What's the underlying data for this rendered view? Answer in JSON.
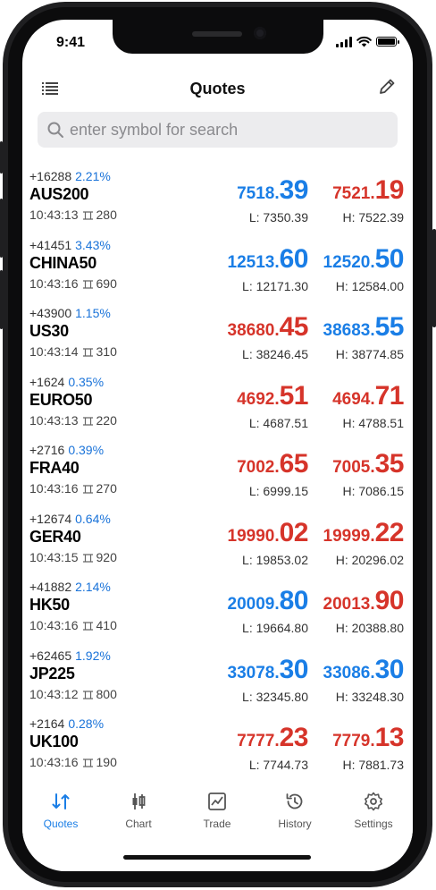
{
  "status": {
    "time": "9:41"
  },
  "header": {
    "title": "Quotes"
  },
  "search": {
    "placeholder": "enter symbol for search"
  },
  "colors": {
    "up": "#1a7ee6",
    "down": "#d6342a",
    "accent": "#1a7ee6"
  },
  "quotes": [
    {
      "change": "+16288",
      "pct": "2.21%",
      "symbol": "AUS200",
      "time": "10:43:13",
      "spread": "280",
      "bid_small": "7518.",
      "bid_big": "39",
      "bid_color": "blue",
      "ask_small": "7521.",
      "ask_big": "19",
      "ask_color": "red",
      "low": "L: 7350.39",
      "high": "H: 7522.39"
    },
    {
      "change": "+41451",
      "pct": "3.43%",
      "symbol": "CHINA50",
      "time": "10:43:16",
      "spread": "690",
      "bid_small": "12513.",
      "bid_big": "60",
      "bid_color": "blue",
      "ask_small": "12520.",
      "ask_big": "50",
      "ask_color": "blue",
      "low": "L: 12171.30",
      "high": "H: 12584.00"
    },
    {
      "change": "+43900",
      "pct": "1.15%",
      "symbol": "US30",
      "time": "10:43:14",
      "spread": "310",
      "bid_small": "38680.",
      "bid_big": "45",
      "bid_color": "red",
      "ask_small": "38683.",
      "ask_big": "55",
      "ask_color": "blue",
      "low": "L: 38246.45",
      "high": "H: 38774.85"
    },
    {
      "change": "+1624",
      "pct": "0.35%",
      "symbol": "EURO50",
      "time": "10:43:13",
      "spread": "220",
      "bid_small": "4692.",
      "bid_big": "51",
      "bid_color": "red",
      "ask_small": "4694.",
      "ask_big": "71",
      "ask_color": "red",
      "low": "L: 4687.51",
      "high": "H: 4788.51"
    },
    {
      "change": "+2716",
      "pct": "0.39%",
      "symbol": "FRA40",
      "time": "10:43:16",
      "spread": "270",
      "bid_small": "7002.",
      "bid_big": "65",
      "bid_color": "red",
      "ask_small": "7005.",
      "ask_big": "35",
      "ask_color": "red",
      "low": "L: 6999.15",
      "high": "H: 7086.15"
    },
    {
      "change": "+12674",
      "pct": "0.64%",
      "symbol": "GER40",
      "time": "10:43:15",
      "spread": "920",
      "bid_small": "19990.",
      "bid_big": "02",
      "bid_color": "red",
      "ask_small": "19999.",
      "ask_big": "22",
      "ask_color": "red",
      "low": "L: 19853.02",
      "high": "H: 20296.02"
    },
    {
      "change": "+41882",
      "pct": "2.14%",
      "symbol": "HK50",
      "time": "10:43:16",
      "spread": "410",
      "bid_small": "20009.",
      "bid_big": "80",
      "bid_color": "blue",
      "ask_small": "20013.",
      "ask_big": "90",
      "ask_color": "red",
      "low": "L: 19664.80",
      "high": "H: 20388.80"
    },
    {
      "change": "+62465",
      "pct": "1.92%",
      "symbol": "JP225",
      "time": "10:43:12",
      "spread": "800",
      "bid_small": "33078.",
      "bid_big": "30",
      "bid_color": "blue",
      "ask_small": "33086.",
      "ask_big": "30",
      "ask_color": "blue",
      "low": "L: 32345.80",
      "high": "H: 33248.30"
    },
    {
      "change": "+2164",
      "pct": "0.28%",
      "symbol": "UK100",
      "time": "10:43:16",
      "spread": "190",
      "bid_small": "7777.",
      "bid_big": "23",
      "bid_color": "red",
      "ask_small": "7779.",
      "ask_big": "13",
      "ask_color": "red",
      "low": "L: 7744.73",
      "high": "H: 7881.73"
    }
  ],
  "tabs": [
    {
      "label": "Quotes",
      "icon": "quotes-icon",
      "active": true
    },
    {
      "label": "Chart",
      "icon": "chart-icon",
      "active": false
    },
    {
      "label": "Trade",
      "icon": "trade-icon",
      "active": false
    },
    {
      "label": "History",
      "icon": "history-icon",
      "active": false
    },
    {
      "label": "Settings",
      "icon": "settings-icon",
      "active": false
    }
  ]
}
